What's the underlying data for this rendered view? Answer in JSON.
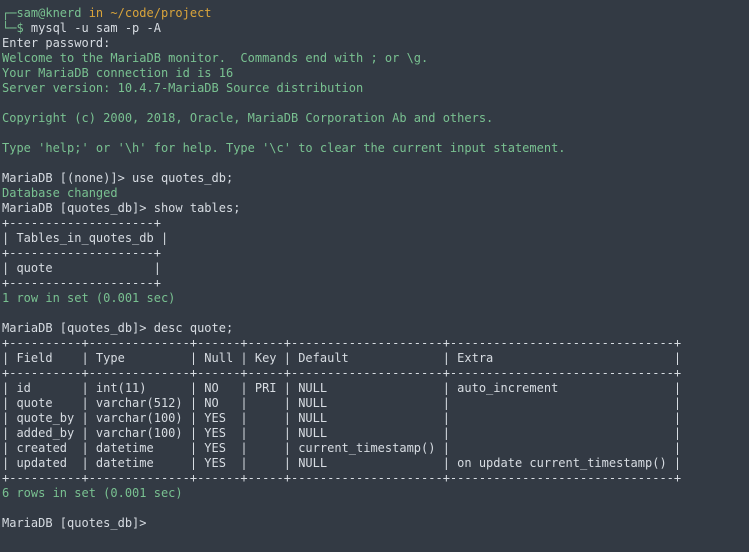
{
  "prompt": {
    "user_host": "sam@knerd",
    "in_word": " in ",
    "path": "~/code/project",
    "command": " mysql -u sam -p -A"
  },
  "output": [
    {
      "text": "Enter password:",
      "tone": "w"
    },
    {
      "text": "Welcome to the MariaDB monitor.  Commands end with ; or \\g.",
      "tone": "g"
    },
    {
      "text": "Your MariaDB connection id is 16",
      "tone": "g"
    },
    {
      "text": "Server version: 10.4.7-MariaDB Source distribution",
      "tone": "g"
    },
    {
      "text": "",
      "tone": "w"
    },
    {
      "text": "Copyright (c) 2000, 2018, Oracle, MariaDB Corporation Ab and others.",
      "tone": "g"
    },
    {
      "text": "",
      "tone": "w"
    },
    {
      "text": "Type 'help;' or '\\h' for help. Type '\\c' to clear the current input statement.",
      "tone": "g"
    },
    {
      "text": "",
      "tone": "w"
    },
    {
      "text": "MariaDB [(none)]> use quotes_db;",
      "tone": "w"
    },
    {
      "text": "Database changed",
      "tone": "g"
    },
    {
      "text": "MariaDB [quotes_db]> show tables;",
      "tone": "w"
    },
    {
      "text": "+--------------------+",
      "tone": "w"
    },
    {
      "text": "| Tables_in_quotes_db |",
      "tone": "w"
    },
    {
      "text": "+--------------------+",
      "tone": "w"
    },
    {
      "text": "| quote              |",
      "tone": "w"
    },
    {
      "text": "+--------------------+",
      "tone": "w"
    },
    {
      "text": "1 row in set (0.001 sec)",
      "tone": "g"
    },
    {
      "text": "",
      "tone": "w"
    },
    {
      "text": "MariaDB [quotes_db]> desc quote;",
      "tone": "w"
    },
    {
      "text": "+----------+--------------+------+-----+---------------------+-------------------------------+",
      "tone": "w"
    },
    {
      "text": "| Field    | Type         | Null | Key | Default             | Extra                         |",
      "tone": "w"
    },
    {
      "text": "+----------+--------------+------+-----+---------------------+-------------------------------+",
      "tone": "w"
    },
    {
      "text": "| id       | int(11)      | NO   | PRI | NULL                | auto_increment                |",
      "tone": "w"
    },
    {
      "text": "| quote    | varchar(512) | NO   |     | NULL                |                               |",
      "tone": "w"
    },
    {
      "text": "| quote_by | varchar(100) | YES  |     | NULL                |                               |",
      "tone": "w"
    },
    {
      "text": "| added_by | varchar(100) | YES  |     | NULL                |                               |",
      "tone": "w"
    },
    {
      "text": "| created  | datetime     | YES  |     | current_timestamp() |                               |",
      "tone": "w"
    },
    {
      "text": "| updated  | datetime     | YES  |     | NULL                | on update current_timestamp() |",
      "tone": "w"
    },
    {
      "text": "+----------+--------------+------+-----+---------------------+-------------------------------+",
      "tone": "w"
    },
    {
      "text": "6 rows in set (0.001 sec)",
      "tone": "g"
    },
    {
      "text": "",
      "tone": "w"
    },
    {
      "text": "MariaDB [quotes_db]> ",
      "tone": "w"
    }
  ]
}
